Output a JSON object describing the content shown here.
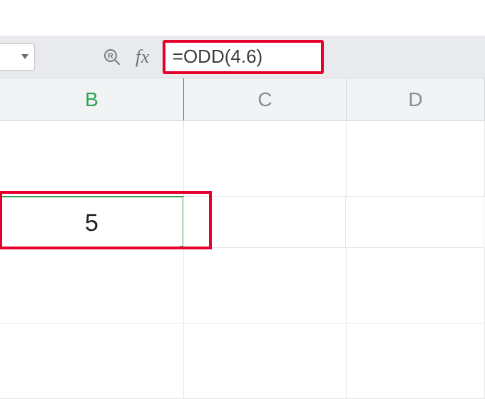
{
  "formula_bar": {
    "fx_label": "fx",
    "formula": "=ODD(4.6)"
  },
  "columns": {
    "B": "B",
    "C": "C",
    "D": "D"
  },
  "cells": {
    "B2": "5"
  },
  "selected_cell": "B2"
}
